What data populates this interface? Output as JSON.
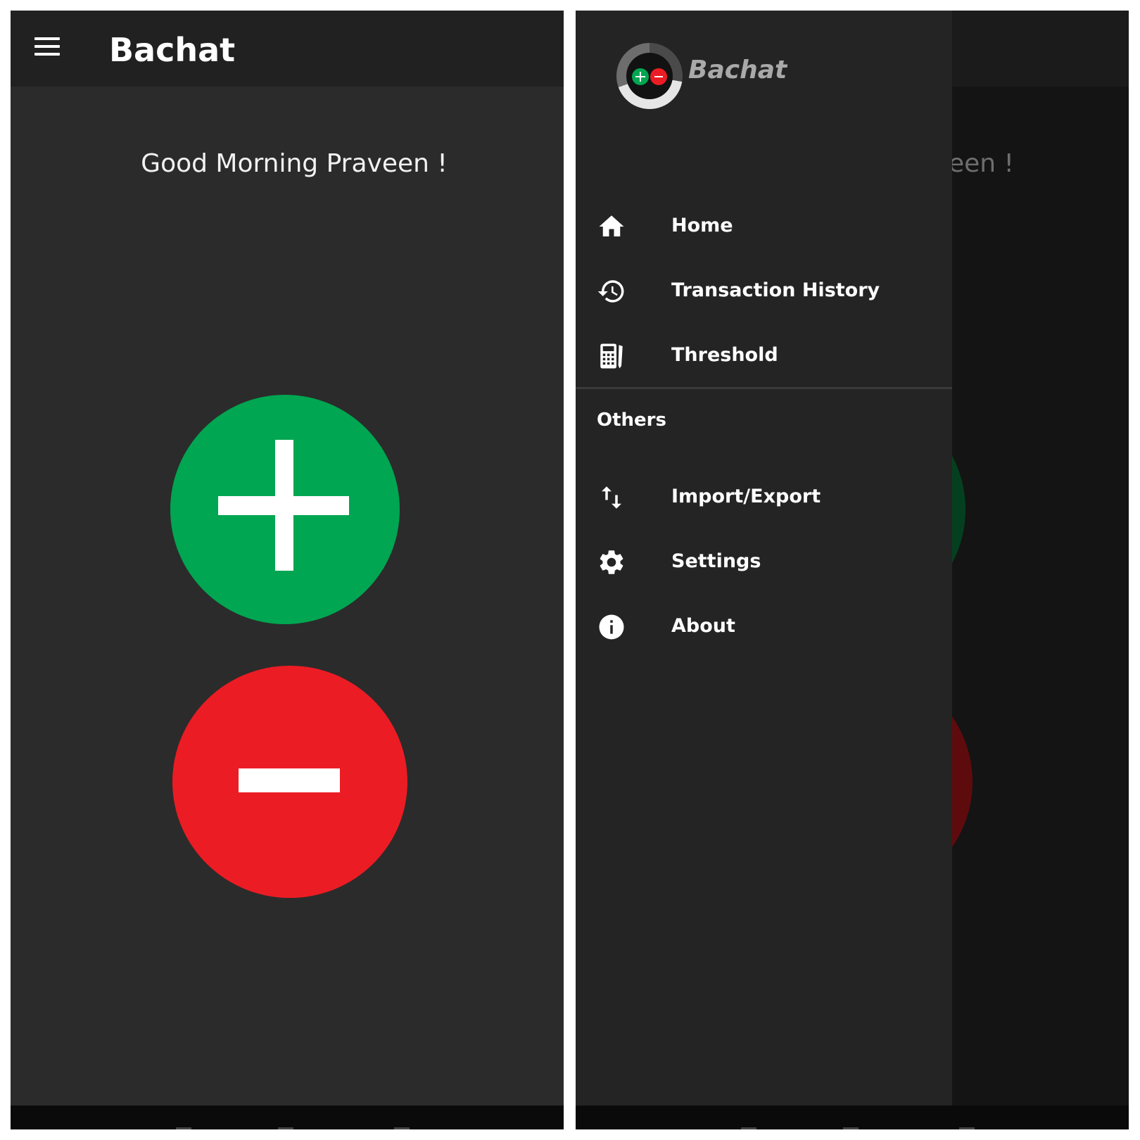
{
  "left": {
    "app_title": "Bachat",
    "greeting": "Good Morning Praveen !",
    "icons": {
      "menu": "menu-icon",
      "add": "plus-icon",
      "subtract": "minus-icon"
    }
  },
  "right": {
    "behind_greeting": "een !",
    "drawer": {
      "brand": "Bachat",
      "items": [
        {
          "label": "Home",
          "icon": "home-icon"
        },
        {
          "label": "Transaction History",
          "icon": "history-icon"
        },
        {
          "label": "Threshold",
          "icon": "calculator-icon"
        }
      ],
      "section_title": "Others",
      "other_items": [
        {
          "label": "Import/Export",
          "icon": "import-export-icon"
        },
        {
          "label": "Settings",
          "icon": "gear-icon"
        },
        {
          "label": "About",
          "icon": "info-icon"
        }
      ]
    }
  },
  "colors": {
    "background": "#2b2b2b",
    "appbar": "#212121",
    "drawer": "#242424",
    "add_green": "#00a651",
    "subtract_red": "#ec1c24",
    "text": "#ffffff"
  }
}
